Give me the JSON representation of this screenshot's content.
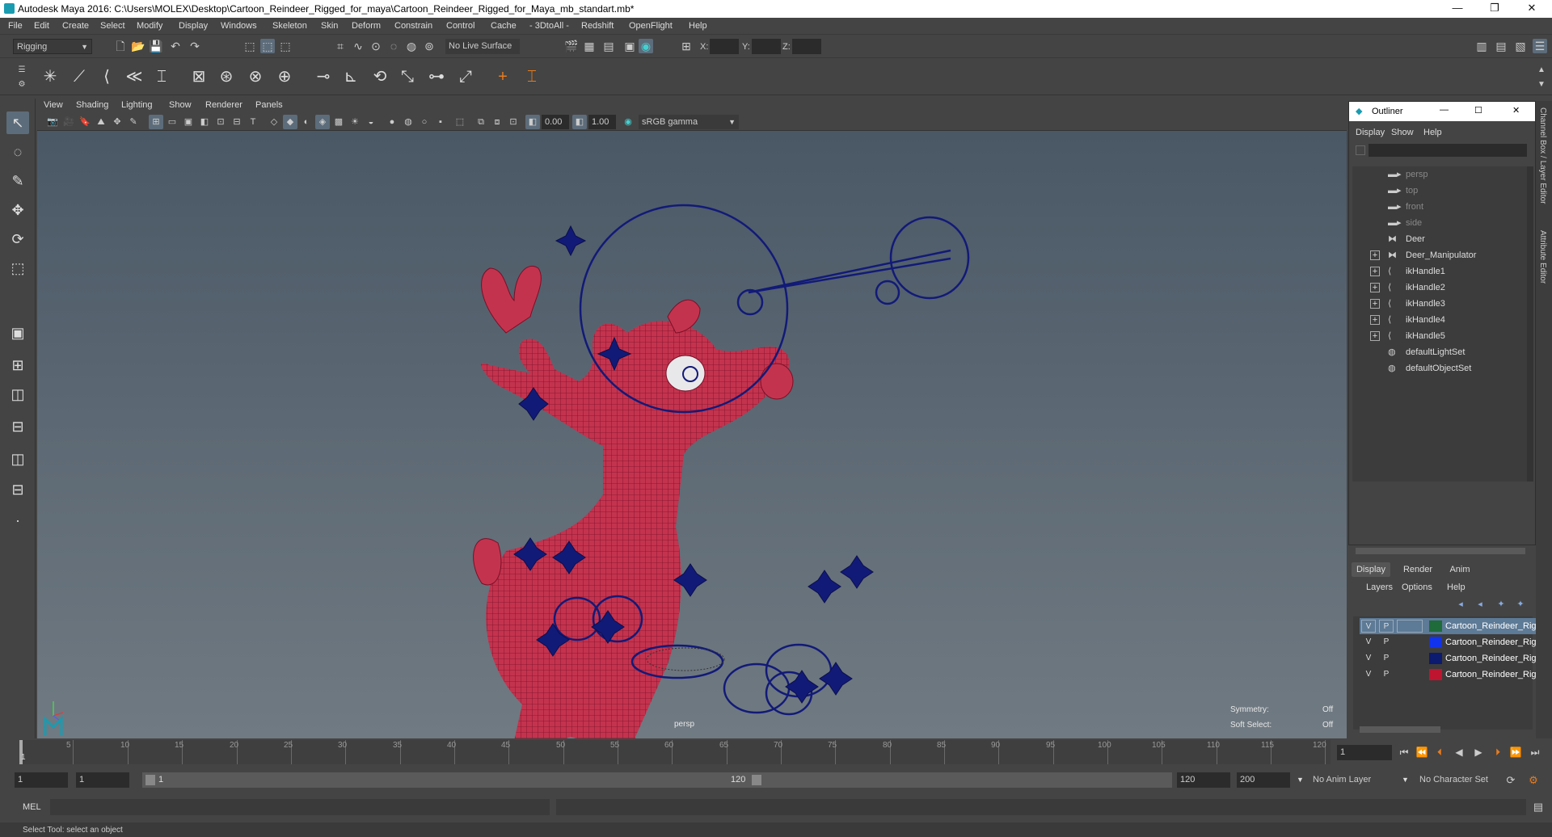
{
  "window": {
    "title": "Autodesk Maya 2016: C:\\Users\\MOLEX\\Desktop\\Cartoon_Reindeer_Rigged_for_maya\\Cartoon_Reindeer_Rigged_for_Maya_mb_standart.mb*",
    "minimize": "—",
    "restore": "❐",
    "close": "✕"
  },
  "menubar": [
    "File",
    "Edit",
    "Create",
    "Select",
    "Modify",
    "Display",
    "Windows",
    "Skeleton",
    "Skin",
    "Deform",
    "Constrain",
    "Control",
    "Cache",
    "- 3DtoAll -",
    "Redshift",
    "OpenFlight",
    "Help"
  ],
  "statusline": {
    "menuset": "Rigging",
    "live_surface": "No Live Surface",
    "x_label": "X:",
    "y_label": "Y:",
    "z_label": "Z:"
  },
  "viewport": {
    "menus": [
      "View",
      "Shading",
      "Lighting",
      "Show",
      "Renderer",
      "Panels"
    ],
    "exposure": "0.00",
    "gamma": "1.00",
    "color_space": "sRGB gamma",
    "camera_label": "persp",
    "symmetry_label": "Symmetry:",
    "symmetry_value": "Off",
    "soft_select_label": "Soft Select:",
    "soft_select_value": "Off"
  },
  "outliner": {
    "title": "Outliner",
    "menus": [
      "Display",
      "Show",
      "Help"
    ],
    "items": [
      {
        "label": "persp",
        "dim": true,
        "expandable": false,
        "icon": "camera-icon"
      },
      {
        "label": "top",
        "dim": true,
        "expandable": false,
        "icon": "camera-icon"
      },
      {
        "label": "front",
        "dim": true,
        "expandable": false,
        "icon": "camera-icon"
      },
      {
        "label": "side",
        "dim": true,
        "expandable": false,
        "icon": "camera-icon"
      },
      {
        "label": "Deer",
        "dim": false,
        "expandable": false,
        "icon": "transform-icon"
      },
      {
        "label": "Deer_Manipulator",
        "dim": false,
        "expandable": true,
        "icon": "transform-icon"
      },
      {
        "label": "ikHandle1",
        "dim": false,
        "expandable": true,
        "icon": "ik-handle-icon"
      },
      {
        "label": "ikHandle2",
        "dim": false,
        "expandable": true,
        "icon": "ik-handle-icon"
      },
      {
        "label": "ikHandle3",
        "dim": false,
        "expandable": true,
        "icon": "ik-handle-icon"
      },
      {
        "label": "ikHandle4",
        "dim": false,
        "expandable": true,
        "icon": "ik-handle-icon"
      },
      {
        "label": "ikHandle5",
        "dim": false,
        "expandable": true,
        "icon": "ik-handle-icon"
      },
      {
        "label": "defaultLightSet",
        "dim": false,
        "expandable": false,
        "icon": "set-icon"
      },
      {
        "label": "defaultObjectSet",
        "dim": false,
        "expandable": false,
        "icon": "set-icon"
      }
    ]
  },
  "layer_editor": {
    "tabs": [
      "Display",
      "Render",
      "Anim"
    ],
    "menus": [
      "Layers",
      "Options",
      "Help"
    ],
    "layers": [
      {
        "v": "V",
        "p": "P",
        "name": "Cartoon_Reindeer_Rigg",
        "color": "#1f6b3a",
        "selected": true
      },
      {
        "v": "V",
        "p": "P",
        "name": "Cartoon_Reindeer_Rigg",
        "color": "#1133ee",
        "selected": false
      },
      {
        "v": "V",
        "p": "P",
        "name": "Cartoon_Reindeer_Rigg",
        "color": "#0c1a70",
        "selected": false
      },
      {
        "v": "V",
        "p": "P",
        "name": "Cartoon_Reindeer_Rigg",
        "color": "#c01530",
        "selected": false
      }
    ]
  },
  "side_tabs": {
    "channel_box": "Channel Box / Layer Editor",
    "attribute_editor": "Attribute Editor"
  },
  "timeline": {
    "ticks": [
      "5",
      "10",
      "15",
      "20",
      "25",
      "30",
      "35",
      "40",
      "45",
      "50",
      "55",
      "60",
      "65",
      "70",
      "75",
      "80",
      "85",
      "90",
      "95",
      "100",
      "105",
      "110",
      "115",
      "120"
    ],
    "start_marker": "1",
    "current_frame": "1"
  },
  "range": {
    "start": "1",
    "anim_start": "1",
    "slider_start": "1",
    "slider_end": "120",
    "anim_end": "120",
    "end": "200",
    "anim_layer": "No Anim Layer",
    "character_set": "No Character Set"
  },
  "command": {
    "label": "MEL"
  },
  "help_line": "Select Tool: select an object",
  "colors": {
    "mesh": "#c4334e",
    "wire": "#7a0f27",
    "controls": "#121a78"
  }
}
